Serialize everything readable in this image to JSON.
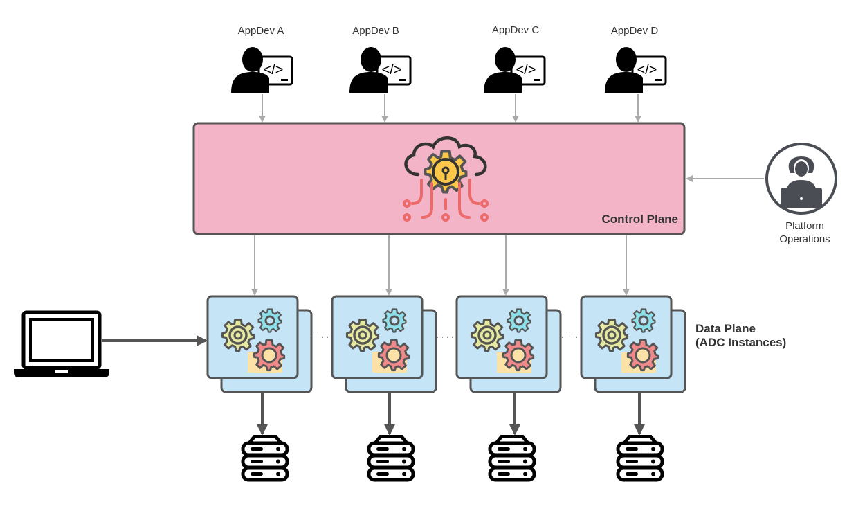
{
  "developers": [
    {
      "label": "AppDev A",
      "icon": "developer-icon"
    },
    {
      "label": "AppDev B",
      "icon": "developer-icon"
    },
    {
      "label": "AppDev C",
      "icon": "developer-icon"
    },
    {
      "label": "AppDev D",
      "icon": "developer-icon"
    }
  ],
  "control_plane": {
    "label": "Control Plane",
    "icon": "cloud-gear-icon",
    "color": "#f4b4c8"
  },
  "platform_ops": {
    "line1": "Platform",
    "line2": "Operations",
    "icon": "operator-laptop-icon"
  },
  "data_plane": {
    "line1": "Data Plane",
    "line2": "(ADC Instances)",
    "color": "#c5e4f5",
    "icon": "gears-icon"
  },
  "client": {
    "icon": "laptop-icon"
  },
  "backends": {
    "icon": "server-stack-icon"
  },
  "colors": {
    "stroke": "#555555",
    "arrow_light": "#aaaaaa",
    "arrow_dark": "#555555"
  }
}
